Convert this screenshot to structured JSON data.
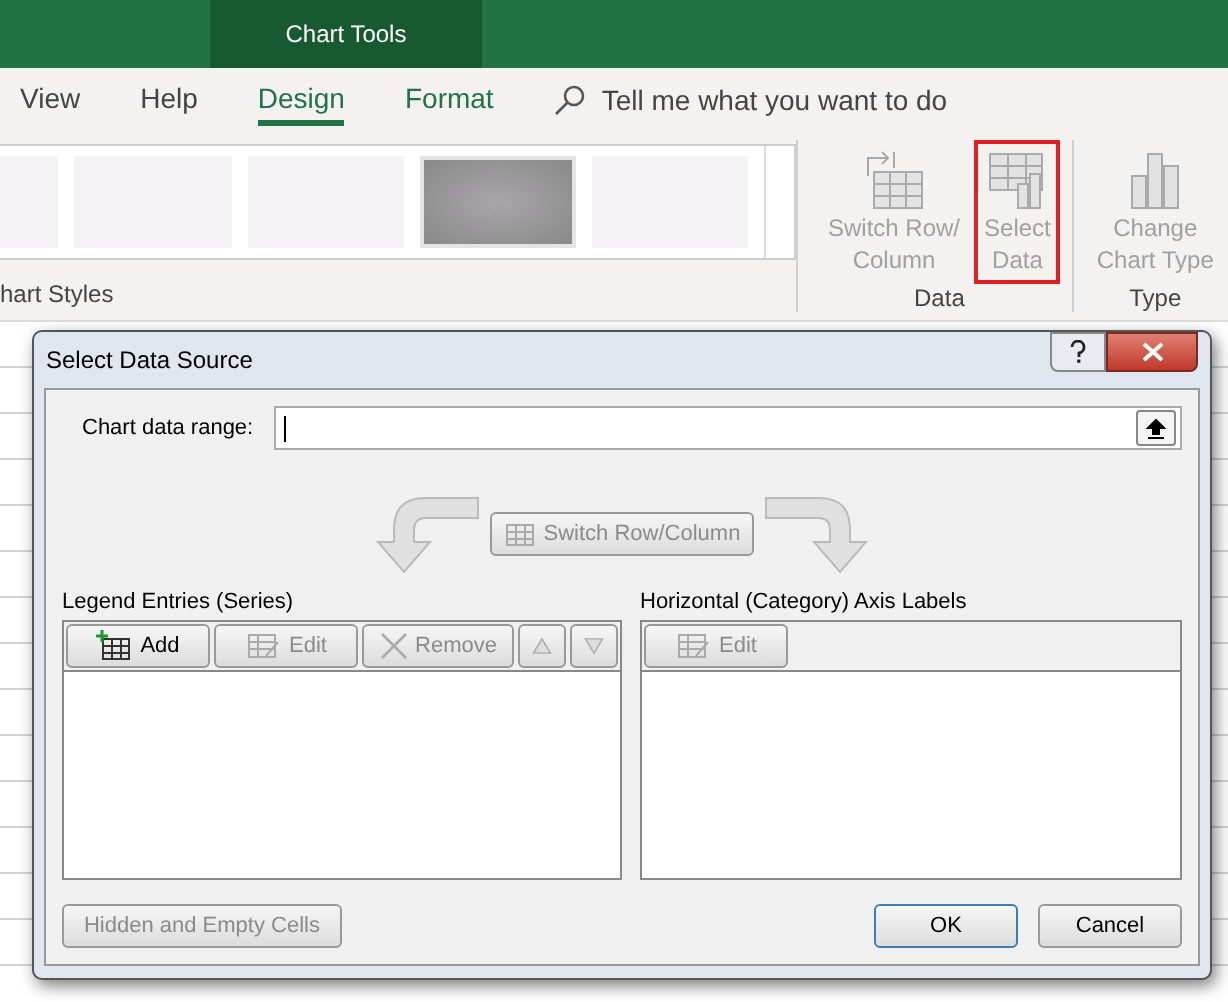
{
  "title_bar": {
    "context_tab": "Chart Tools"
  },
  "ribbon_tabs": [
    {
      "label": "View",
      "selected": false,
      "kind": "plain"
    },
    {
      "label": "Help",
      "selected": false,
      "kind": "plain"
    },
    {
      "label": "Design",
      "selected": true,
      "kind": "contextual"
    },
    {
      "label": "Format",
      "selected": false,
      "kind": "contextual"
    }
  ],
  "tell_me": {
    "placeholder": "Tell me what you want to do"
  },
  "chart_styles": {
    "label": "hart Styles",
    "thumbnails": [
      {
        "kind": "light"
      },
      {
        "kind": "light"
      },
      {
        "kind": "light"
      },
      {
        "kind": "gray"
      },
      {
        "kind": "light"
      }
    ]
  },
  "data_group": {
    "label": "Data",
    "buttons": [
      {
        "kind": "switch",
        "label": "Switch Row/\nColumn",
        "highlighted": false
      },
      {
        "kind": "select",
        "label": "Select\nData",
        "highlighted": true
      }
    ]
  },
  "type_group": {
    "label": "Type",
    "buttons": [
      {
        "kind": "chart",
        "label": "Change\nChart Type",
        "highlighted": false
      }
    ]
  },
  "dialog": {
    "title": "Select Data Source",
    "range_label": "Chart data range:",
    "switch_button": {
      "label": "Switch Row/Column",
      "disabled": true
    },
    "legend": {
      "title": "Legend Entries (Series)",
      "buttons": [
        {
          "kind": "add",
          "label": "Add",
          "disabled": false
        },
        {
          "kind": "edit",
          "label": "Edit",
          "disabled": true
        },
        {
          "kind": "remove",
          "label": "Remove",
          "disabled": true
        },
        {
          "kind": "up",
          "disabled": true
        },
        {
          "kind": "down",
          "disabled": true
        }
      ]
    },
    "axis": {
      "title": "Horizontal (Category) Axis Labels",
      "buttons": [
        {
          "kind": "edit",
          "label": "Edit",
          "disabled": true
        }
      ]
    },
    "hidden_button": {
      "label": "Hidden and Empty Cells",
      "disabled": true
    },
    "ok_button": {
      "label": "OK",
      "default": true
    },
    "cancel_button": {
      "label": "Cancel",
      "default": false
    }
  }
}
